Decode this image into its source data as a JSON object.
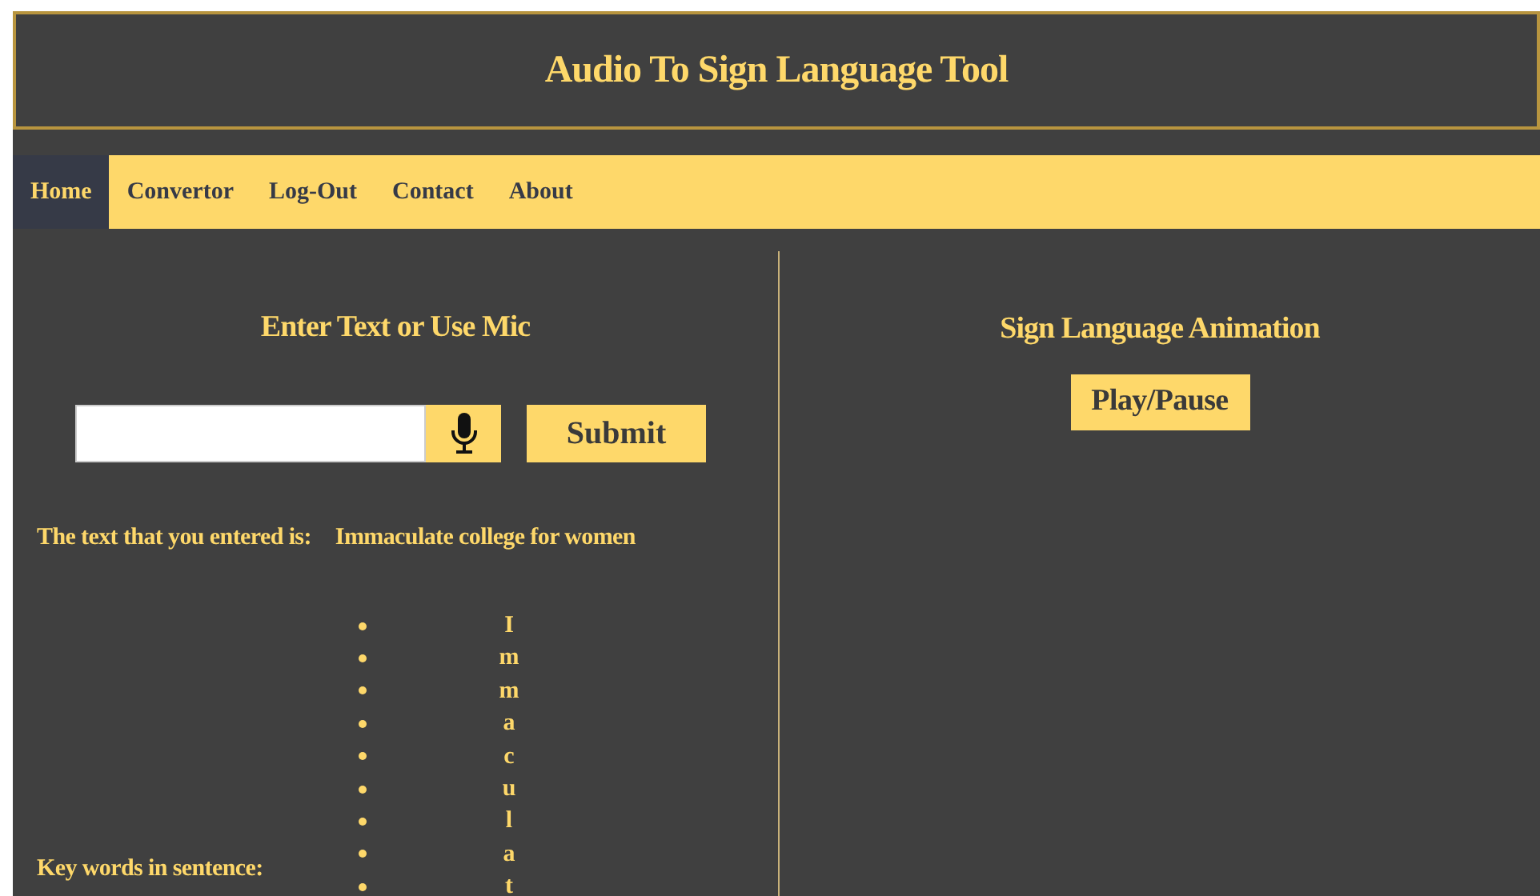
{
  "header": {
    "title": "Audio To Sign Language Tool"
  },
  "nav": [
    {
      "label": "Home",
      "selected": true
    },
    {
      "label": "Convertor",
      "selected": false
    },
    {
      "label": "Log-Out",
      "selected": false
    },
    {
      "label": "Contact",
      "selected": false
    },
    {
      "label": "About",
      "selected": false
    }
  ],
  "input_panel": {
    "heading": "Enter Text or Use Mic",
    "submit": "Submit",
    "entered_label": "The text that you entered is:",
    "entered_text": "Immaculate college for women",
    "keywords_label": "Key words in sentence:",
    "keywords": [
      "I",
      "m",
      "m",
      "a",
      "c",
      "u",
      "l",
      "a",
      "t"
    ]
  },
  "animation_panel": {
    "heading": "Sign Language Animation",
    "play_button": "Play/Pause"
  }
}
